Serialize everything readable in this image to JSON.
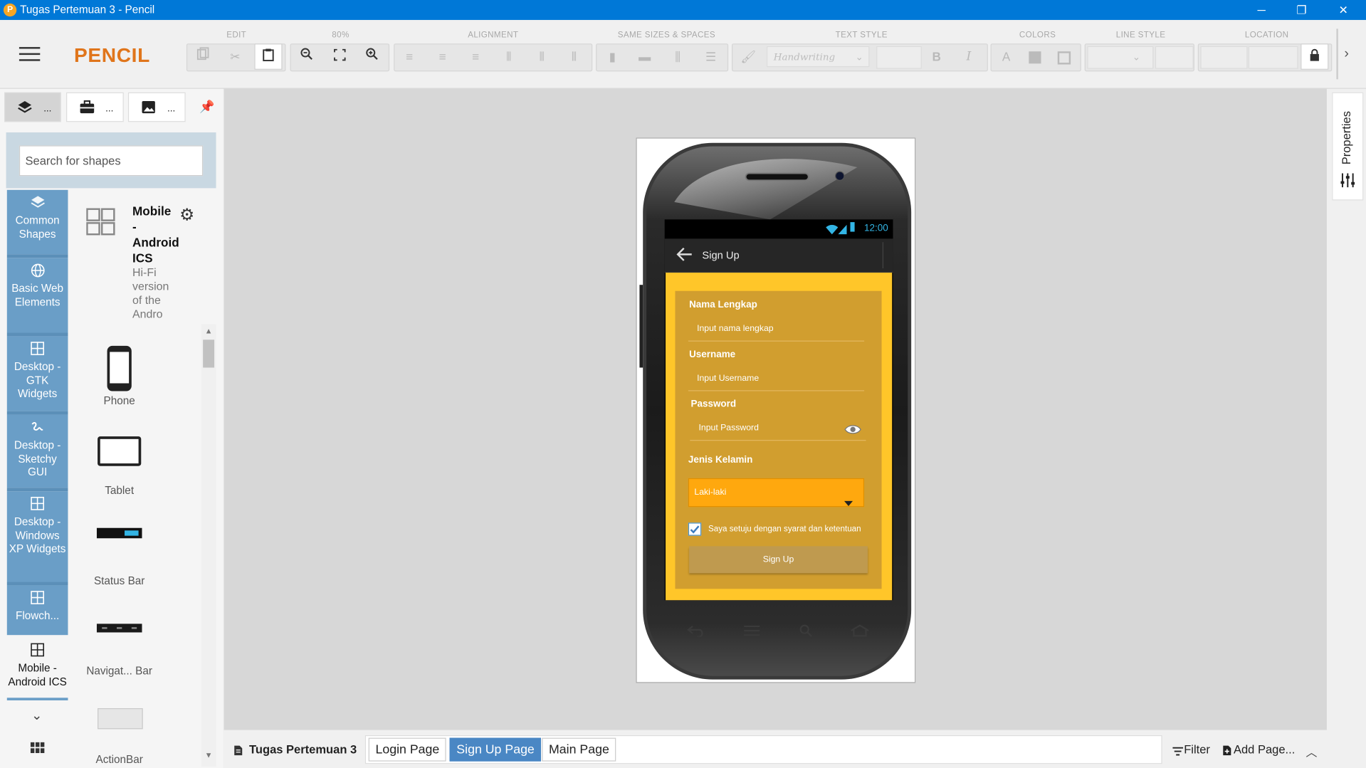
{
  "window": {
    "title": "Tugas Pertemuan 3 - Pencil",
    "controls": [
      "─",
      "❐",
      "✕"
    ]
  },
  "toolbar": {
    "brand": "PENCIL",
    "groups": [
      "EDIT",
      "80%",
      "ALIGNMENT",
      "SAME SIZES & SPACES",
      "TEXT STYLE",
      "COLORS",
      "LINE STYLE",
      "LOCATION"
    ],
    "font_name": "Handwriting"
  },
  "left_panel": {
    "tabs": [
      "...",
      "...",
      "..."
    ],
    "search_placeholder": "Search for shapes",
    "categories": [
      {
        "label": "Common Shapes",
        "icon": "layers-icon"
      },
      {
        "label": "Basic Web Elements",
        "icon": "globe-icon"
      },
      {
        "label": "Desktop - GTK Widgets",
        "icon": "grid-icon"
      },
      {
        "label": "Desktop - Sketchy GUI",
        "icon": "squiggle-icon"
      },
      {
        "label": "Desktop - Windows XP Widgets",
        "icon": "grid-icon"
      },
      {
        "label": "Flowch...",
        "icon": "grid-icon"
      },
      {
        "label": "Mobile - Android ICS",
        "icon": "grid-icon"
      }
    ],
    "collection": {
      "name": "Mobile - Android ICS",
      "description": "Hi-Fi version of the Andro"
    },
    "shapes": [
      "Phone",
      "Tablet",
      "Status Bar",
      "Navigat... Bar",
      "ActionBar"
    ]
  },
  "mockup": {
    "status_time": "12:00",
    "action_bar_title": "Sign Up",
    "fields": [
      {
        "label": "Nama Lengkap",
        "placeholder": "Input nama lengkap"
      },
      {
        "label": "Username",
        "placeholder": "Input Username"
      },
      {
        "label": "Password",
        "placeholder": "Input Password"
      }
    ],
    "gender_label": "Jenis Kelamin",
    "gender_value": "Laki-laki",
    "agree_text": "Saya setuju dengan syarat dan ketentuan",
    "agree_checked": true,
    "signup_button": "Sign Up",
    "colors": {
      "form_outer": "#ffc629",
      "form_inner": "#d19e2f",
      "dropdown": "#ffa80e",
      "button": "#bf9a4f"
    }
  },
  "right_panel": {
    "label": "Properties"
  },
  "bottom": {
    "document": "Tugas Pertemuan 3",
    "pages": [
      "Login Page",
      "Sign Up Page",
      "Main Page"
    ],
    "active_page": "Sign Up Page",
    "filter": "Filter",
    "add_page": "Add Page..."
  }
}
